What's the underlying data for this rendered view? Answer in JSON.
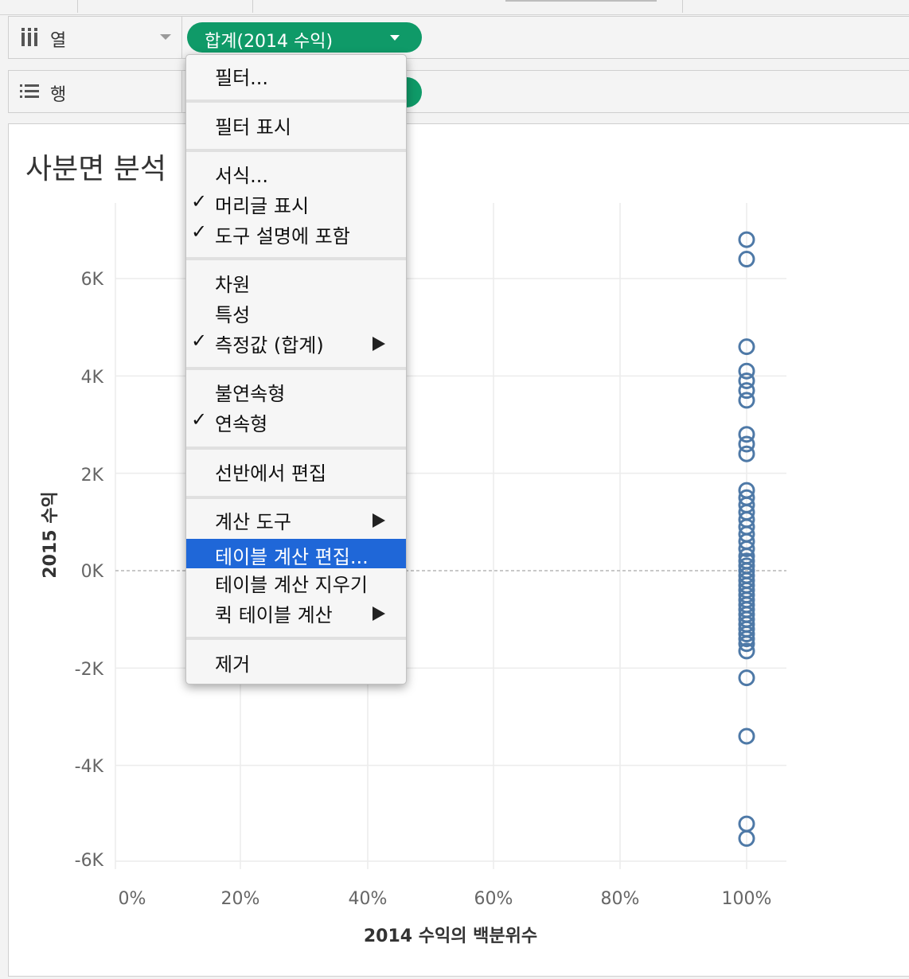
{
  "shelves": {
    "columns": {
      "label": "열",
      "pill": "합계(2014 수익)"
    },
    "rows": {
      "label": "행"
    }
  },
  "sheet": {
    "title": "사분면 분석"
  },
  "context_menu": {
    "items": [
      {
        "label": "필터...",
        "checked": false,
        "submenu": false,
        "highlighted": false
      },
      {
        "label": "필터 표시",
        "checked": false,
        "submenu": false,
        "highlighted": false
      },
      {
        "label": "서식...",
        "checked": false,
        "submenu": false,
        "highlighted": false
      },
      {
        "label": "머리글 표시",
        "checked": true,
        "submenu": false,
        "highlighted": false
      },
      {
        "label": "도구 설명에 포함",
        "checked": true,
        "submenu": false,
        "highlighted": false
      },
      {
        "label": "차원",
        "checked": false,
        "submenu": false,
        "highlighted": false
      },
      {
        "label": "특성",
        "checked": false,
        "submenu": false,
        "highlighted": false
      },
      {
        "label": "측정값 (합계)",
        "checked": true,
        "submenu": true,
        "highlighted": false
      },
      {
        "label": "불연속형",
        "checked": false,
        "submenu": false,
        "highlighted": false
      },
      {
        "label": "연속형",
        "checked": true,
        "submenu": false,
        "highlighted": false
      },
      {
        "label": "선반에서 편집",
        "checked": false,
        "submenu": false,
        "highlighted": false
      },
      {
        "label": "계산 도구",
        "checked": false,
        "submenu": true,
        "highlighted": false
      },
      {
        "label": "테이블 계산 편집...",
        "checked": false,
        "submenu": false,
        "highlighted": true
      },
      {
        "label": "테이블 계산 지우기",
        "checked": false,
        "submenu": false,
        "highlighted": false
      },
      {
        "label": "퀵 테이블 계산",
        "checked": false,
        "submenu": true,
        "highlighted": false
      },
      {
        "label": "제거",
        "checked": false,
        "submenu": false,
        "highlighted": false
      }
    ],
    "check_glyph": "✓"
  },
  "chart_data": {
    "type": "scatter",
    "xlabel": "2014 수익의 백분위수",
    "ylabel": "2015 수익",
    "x_ticks": [
      "0%",
      "20%",
      "40%",
      "60%",
      "80%",
      "100%"
    ],
    "y_ticks": [
      "6K",
      "4K",
      "2K",
      "0K",
      "-2K",
      "-4K",
      "-6K"
    ],
    "xlim": [
      0,
      1
    ],
    "ylim": [
      -6000,
      6000
    ],
    "grid": true,
    "zero_line": "dashed",
    "marker": "open-circle",
    "color": "#4e79a7",
    "x": [
      1,
      1,
      1,
      1,
      1,
      1,
      1,
      1,
      1,
      1,
      1,
      1,
      1,
      1,
      1,
      1,
      1,
      1,
      1,
      1,
      1,
      1,
      1,
      1,
      1,
      1,
      1,
      1,
      1,
      1,
      1,
      1,
      1,
      1,
      1,
      1,
      1,
      1,
      1,
      1,
      1,
      1,
      1,
      1,
      1
    ],
    "y": [
      6800,
      6400,
      4600,
      4100,
      3900,
      3700,
      3500,
      2800,
      2600,
      2400,
      1650,
      1500,
      1350,
      1200,
      1050,
      900,
      750,
      600,
      450,
      300,
      200,
      100,
      0,
      -100,
      -200,
      -300,
      -400,
      -500,
      -600,
      -700,
      -800,
      -900,
      -1000,
      -1100,
      -1200,
      -1300,
      -1400,
      -1500,
      -1650,
      -2200,
      -3400,
      -5200,
      -5500
    ]
  }
}
